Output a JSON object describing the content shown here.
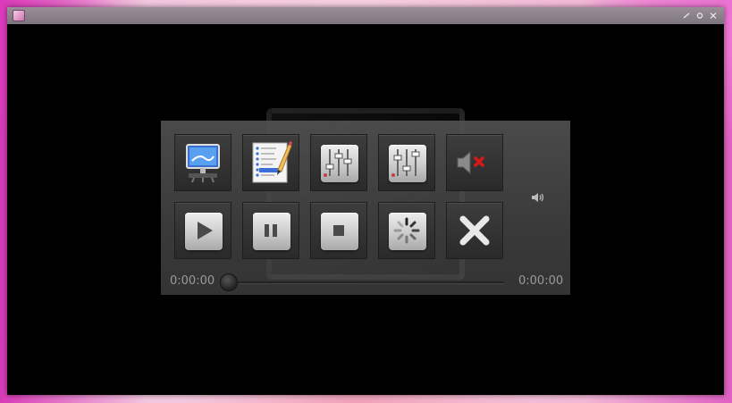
{
  "window": {
    "title": "",
    "controls": [
      "minimize",
      "maximize",
      "close"
    ]
  },
  "player": {
    "row1": [
      {
        "name": "display-button",
        "icon": "monitor-icon"
      },
      {
        "name": "playlist-button",
        "icon": "playlist-pen-icon"
      },
      {
        "name": "equalizer-button",
        "icon": "equalizer-sliders-icon"
      },
      {
        "name": "settings-sliders-button",
        "icon": "sliders-icon"
      },
      {
        "name": "mute-button",
        "icon": "speaker-muted-icon"
      }
    ],
    "row2": [
      {
        "name": "play-button",
        "icon": "play-icon"
      },
      {
        "name": "pause-button",
        "icon": "pause-icon"
      },
      {
        "name": "stop-button",
        "icon": "stop-icon"
      },
      {
        "name": "loading-button",
        "icon": "spinner-icon"
      },
      {
        "name": "close-player-button",
        "icon": "close-x-icon"
      }
    ],
    "volume_icon": "speaker-volume-icon",
    "time_elapsed": "0:00:00",
    "time_total": "0:00:00",
    "progress": 0
  },
  "colors": {
    "panel": "#3c3c3c",
    "button_face": "#d8d8d8",
    "mute_x": "#d81818",
    "close_x": "#e8e8e8"
  }
}
